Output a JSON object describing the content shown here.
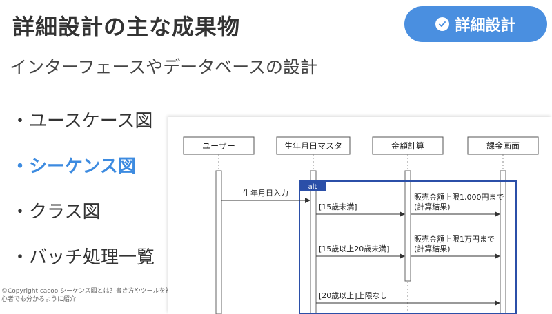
{
  "slide": {
    "title": "詳細設計の主な成果物",
    "badge_label": "詳細設計",
    "subtitle": "インターフェースやデータベースの設計",
    "bullets": [
      {
        "dot": "・",
        "label": "ユースケース図",
        "active": false
      },
      {
        "dot": "・",
        "label": "シーケンス図",
        "active": true
      },
      {
        "dot": "・",
        "label": "クラス図",
        "active": false
      },
      {
        "dot": "・",
        "label": "バッチ処理一覧",
        "active": false
      }
    ],
    "copyright": "©Copyright cacoo シーケンス図とは？書き方やツールを初心者でも分かるように紹介"
  },
  "colors": {
    "accent": "#4a8fe0",
    "active_text": "#3d8be0",
    "alt_frame": "#2b4fa8"
  },
  "diagram": {
    "actors": [
      "ユーザー",
      "生年月日マスタ",
      "金額計算",
      "課金画面"
    ],
    "frame_label": "alt",
    "messages": [
      {
        "label": "生年月日入力"
      },
      {
        "label": "[15歳未満]"
      },
      {
        "label": "販売金額上限1,000円まで"
      },
      {
        "label": "(計算結果)"
      },
      {
        "label": "販売金額上限1万円まで"
      },
      {
        "label": "(計算結果)"
      },
      {
        "label": "[15歳以上20歳未満]"
      },
      {
        "label": "[20歳以上]上限なし"
      }
    ]
  }
}
